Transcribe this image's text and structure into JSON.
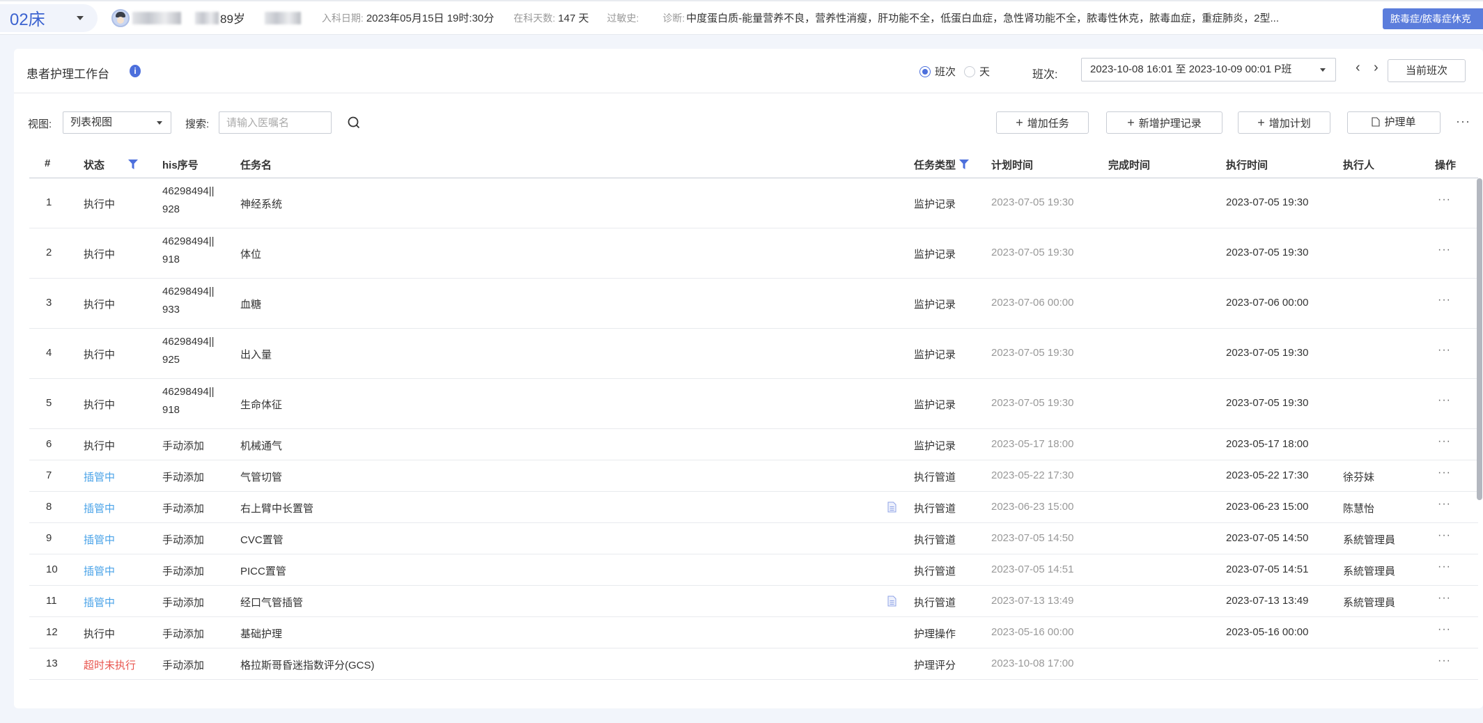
{
  "topbar": {
    "bed": "02床",
    "patient_age": "89岁",
    "admit_label": "入科日期:",
    "admit_value": "2023年05月15日 19时:30分",
    "days_label": "在科天数:",
    "days_value": "147 天",
    "allergy_label": "过敏史:",
    "allergy_value": "",
    "diag_label": "诊断:",
    "diag_value": "中度蛋白质-能量营养不良，营养性消瘦，肝功能不全，低蛋白血症，急性肾功能不全，脓毒性休克，脓毒血症，重症肺炎，2型...",
    "diag_tag": "脓毒症/脓毒症休克"
  },
  "header": {
    "title": "患者护理工作台",
    "info_icon": "i",
    "radio_shift": "班次",
    "radio_day": "天",
    "shift_label": "班次:",
    "shift_value": "2023-10-08 16:01 至 2023-10-09 00:01 P班",
    "prev": "‹",
    "next": "›",
    "current_shift": "当前班次"
  },
  "toolbar": {
    "view_label": "视图:",
    "view_value": "列表视图",
    "search_label": "搜索:",
    "search_placeholder": "请输入医嘱名",
    "search_value": "",
    "add_task": "增加任务",
    "add_record": "新增护理记录",
    "add_plan": "增加计划",
    "care_sheet": "护理单",
    "more": "···"
  },
  "table": {
    "columns": {
      "index": "#",
      "status": "状态",
      "his": "his序号",
      "name": "任务名",
      "type": "任务类型",
      "plan_time": "计划时间",
      "done_time": "完成时间",
      "exec_time": "执行时间",
      "executor": "执行人",
      "ops": "操作"
    },
    "rows": [
      {
        "index": "1",
        "status": "执行中",
        "status_kind": "active",
        "his1": "46298494||",
        "his2": "928",
        "name": "神经系统",
        "doc": false,
        "type": "监护记录",
        "plan_time": "2023-07-05 19:30",
        "done_time": "",
        "exec_time": "2023-07-05 19:30",
        "executor": "",
        "ops": "···"
      },
      {
        "index": "2",
        "status": "执行中",
        "status_kind": "active",
        "his1": "46298494||",
        "his2": "918",
        "name": "体位",
        "doc": false,
        "type": "监护记录",
        "plan_time": "2023-07-05 19:30",
        "done_time": "",
        "exec_time": "2023-07-05 19:30",
        "executor": "",
        "ops": "···"
      },
      {
        "index": "3",
        "status": "执行中",
        "status_kind": "active",
        "his1": "46298494||",
        "his2": "933",
        "name": "血糖",
        "doc": false,
        "type": "监护记录",
        "plan_time": "2023-07-06 00:00",
        "done_time": "",
        "exec_time": "2023-07-06 00:00",
        "executor": "",
        "ops": "···"
      },
      {
        "index": "4",
        "status": "执行中",
        "status_kind": "active",
        "his1": "46298494||",
        "his2": "925",
        "name": "出入量",
        "doc": false,
        "type": "监护记录",
        "plan_time": "2023-07-05 19:30",
        "done_time": "",
        "exec_time": "2023-07-05 19:30",
        "executor": "",
        "ops": "···"
      },
      {
        "index": "5",
        "status": "执行中",
        "status_kind": "active",
        "his1": "46298494||",
        "his2": "918",
        "name": "生命体征",
        "doc": false,
        "type": "监护记录",
        "plan_time": "2023-07-05 19:30",
        "done_time": "",
        "exec_time": "2023-07-05 19:30",
        "executor": "",
        "ops": "···"
      },
      {
        "index": "6",
        "status": "执行中",
        "status_kind": "active",
        "his1": "手动添加",
        "his2": "",
        "name": "机械通气",
        "doc": false,
        "type": "监护记录",
        "plan_time": "2023-05-17 18:00",
        "done_time": "",
        "exec_time": "2023-05-17 18:00",
        "executor": "",
        "ops": "···"
      },
      {
        "index": "7",
        "status": "插管中",
        "status_kind": "cath",
        "his1": "手动添加",
        "his2": "",
        "name": "气管切管",
        "doc": false,
        "type": "执行管道",
        "plan_time": "2023-05-22 17:30",
        "done_time": "",
        "exec_time": "2023-05-22 17:30",
        "executor": "徐芬妹",
        "ops": "···"
      },
      {
        "index": "8",
        "status": "插管中",
        "status_kind": "cath",
        "his1": "手动添加",
        "his2": "",
        "name": "右上臂中长置管",
        "doc": true,
        "type": "执行管道",
        "plan_time": "2023-06-23 15:00",
        "done_time": "",
        "exec_time": "2023-06-23 15:00",
        "executor": "陈慧怡",
        "ops": "···"
      },
      {
        "index": "9",
        "status": "插管中",
        "status_kind": "cath",
        "his1": "手动添加",
        "his2": "",
        "name": "CVC置管",
        "doc": false,
        "type": "执行管道",
        "plan_time": "2023-07-05 14:50",
        "done_time": "",
        "exec_time": "2023-07-05 14:50",
        "executor": "系統管理員",
        "ops": "···"
      },
      {
        "index": "10",
        "status": "插管中",
        "status_kind": "cath",
        "his1": "手动添加",
        "his2": "",
        "name": "PICC置管",
        "doc": false,
        "type": "执行管道",
        "plan_time": "2023-07-05 14:51",
        "done_time": "",
        "exec_time": "2023-07-05 14:51",
        "executor": "系統管理員",
        "ops": "···"
      },
      {
        "index": "11",
        "status": "插管中",
        "status_kind": "cath",
        "his1": "手动添加",
        "his2": "",
        "name": "经口气管插管",
        "doc": true,
        "type": "执行管道",
        "plan_time": "2023-07-13 13:49",
        "done_time": "",
        "exec_time": "2023-07-13 13:49",
        "executor": "系統管理員",
        "ops": "···"
      },
      {
        "index": "12",
        "status": "执行中",
        "status_kind": "active",
        "his1": "手动添加",
        "his2": "",
        "name": "基础护理",
        "doc": false,
        "type": "护理操作",
        "plan_time": "2023-05-16 00:00",
        "done_time": "",
        "exec_time": "2023-05-16 00:00",
        "executor": "",
        "ops": "···"
      },
      {
        "index": "13",
        "status": "超时未执行",
        "status_kind": "overdue",
        "his1": "手动添加",
        "his2": "",
        "name": "格拉斯哥昏迷指数评分(GCS)",
        "doc": false,
        "type": "护理评分",
        "plan_time": "2023-10-08 17:00",
        "done_time": "",
        "exec_time": "",
        "executor": "",
        "ops": "···"
      }
    ]
  },
  "colors": {
    "accent": "#4c6fdc",
    "status_cath": "#4aa3e8",
    "status_overdue": "#e8554e",
    "diag_tag_bg": "#5b7ddc"
  }
}
